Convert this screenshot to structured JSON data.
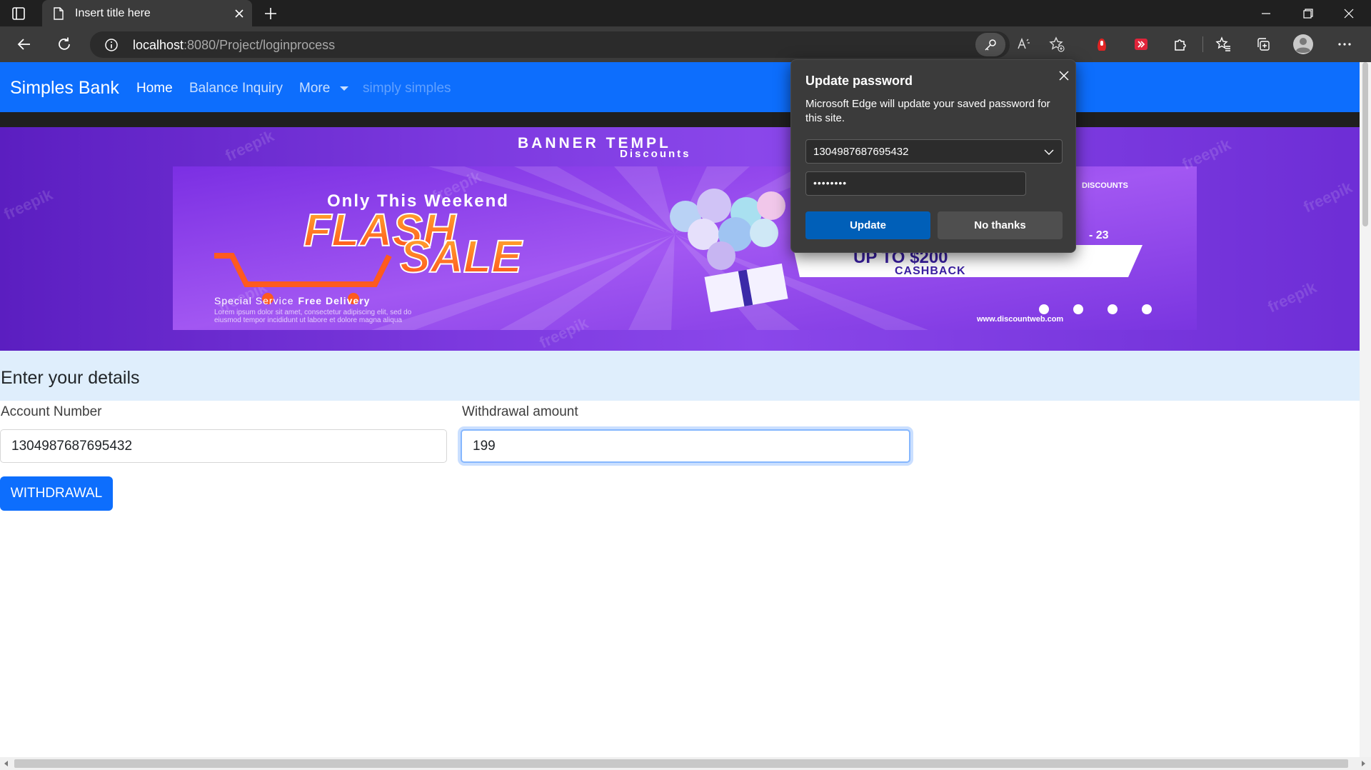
{
  "browser": {
    "tab": {
      "title": "Insert title here"
    },
    "address": {
      "host": "localhost",
      "path": ":8080/Project/loginprocess"
    },
    "icons": {
      "tab_actions": "tab-actions-icon",
      "page": "page-icon",
      "close": "close-icon",
      "new_tab": "plus-icon",
      "back": "back-arrow-icon",
      "refresh": "refresh-icon",
      "site_info": "info-icon",
      "password_key": "key-icon",
      "read_aloud": "read-aloud-icon",
      "add_favorite": "star-plus-icon",
      "extension_red": "extension-icon",
      "extension_red2": "extension-icon",
      "extensions": "puzzle-icon",
      "favorites": "favorites-icon",
      "collections": "collections-icon",
      "profile": "avatar-icon",
      "more": "ellipsis-icon"
    }
  },
  "navbar": {
    "brand": "Simples Bank",
    "links": [
      "Home",
      "Balance Inquiry",
      "More",
      "simply simples"
    ],
    "color": "#0d6efd"
  },
  "banner": {
    "heading": "BANNER TEMPL",
    "subheading": "Discounts",
    "tagline": "Only This Weekend",
    "headline_1": "FLASH",
    "headline_2": "SALE",
    "service": "Special Service",
    "service_bold": "Free Delivery",
    "lorem_1": "Lorem ipsum dolor sit amet, consectetur adipiscing elit, sed do",
    "lorem_2": "eiusmod tempor incididunt ut labore et dolore magna aliqua",
    "cashback_1": "UP TO $200",
    "cashback_2": "CASHBACK",
    "logo": "DISCOUNTS",
    "date": "- 23",
    "website": "www.discountweb.com",
    "watermark": "freepik",
    "colors": {
      "start": "#5b1ec0",
      "end": "#6d2dd5"
    }
  },
  "form": {
    "section_title": "Enter your details",
    "account_label": "Account Number",
    "account_value": "1304987687695432",
    "amount_label": "Withdrawal amount",
    "amount_value": "199",
    "submit_label": "WITHDRAWAL"
  },
  "password_popup": {
    "title": "Update password",
    "description": "Microsoft Edge will update your saved password for this site.",
    "username": "1304987687695432",
    "password_mask": "••••••••",
    "update_label": "Update",
    "decline_label": "No thanks"
  }
}
